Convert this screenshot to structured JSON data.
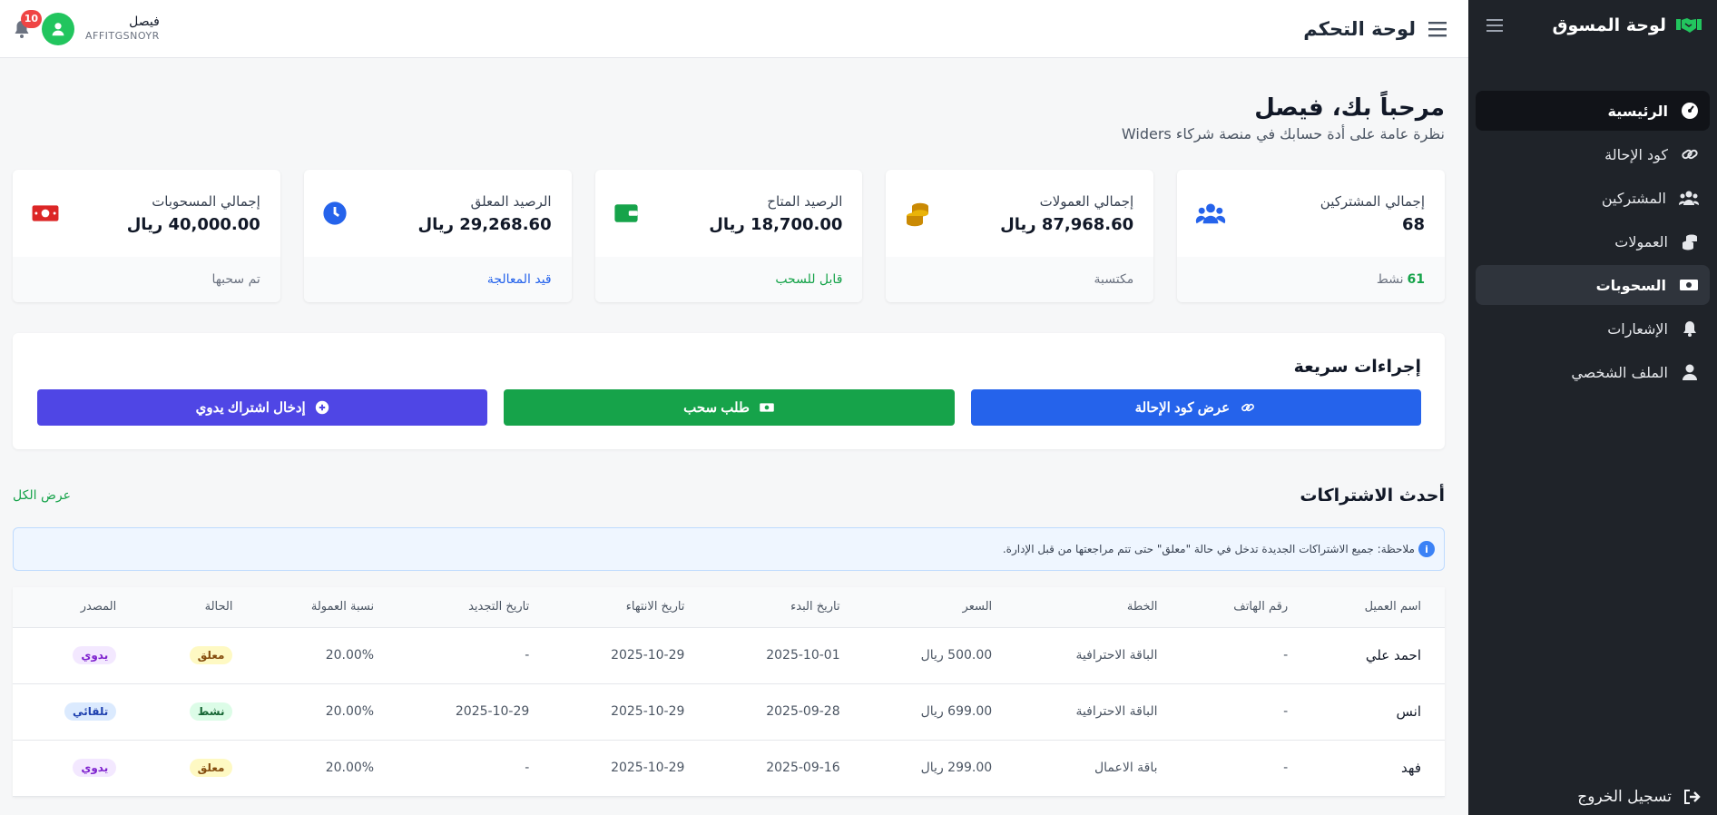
{
  "sidebar": {
    "brand": "لوحة المسوق",
    "items": [
      {
        "label": "الرئيسية",
        "icon": "gauge-icon",
        "state": "active"
      },
      {
        "label": "كود الإحالة",
        "icon": "link-icon",
        "state": ""
      },
      {
        "label": "المشتركين",
        "icon": "users-icon",
        "state": ""
      },
      {
        "label": "العمولات",
        "icon": "coins-icon",
        "state": ""
      },
      {
        "label": "السحوبات",
        "icon": "money-bill-icon",
        "state": "hover"
      },
      {
        "label": "الإشعارات",
        "icon": "bell-icon",
        "state": ""
      },
      {
        "label": "الملف الشخصي",
        "icon": "user-icon",
        "state": ""
      }
    ],
    "logout": "تسجيل الخروج"
  },
  "topbar": {
    "title": "لوحة التحكم",
    "user_name": "فيصل",
    "user_code": "AFFITGSNOYR",
    "notifications": "10"
  },
  "main": {
    "greeting": "مرحباً بك، فيصل",
    "subtitle": "نظرة عامة على أدة حسابك في منصة شركاء Widers"
  },
  "stats": [
    {
      "label": "إجمالي المشتركين",
      "value": "68",
      "footer_num": "61",
      "footer": "نشط",
      "icon": "users-icon",
      "color": "#2563eb"
    },
    {
      "label": "إجمالي العمولات",
      "value": "87,968.60 ريال",
      "footer": "مكتسبة",
      "icon": "coins-icon",
      "color": "#ca8a04"
    },
    {
      "label": "الرصيد المتاح",
      "value": "18,700.00 ريال",
      "footer": "قابل للسحب",
      "icon": "wallet-icon",
      "color": "#16a34a"
    },
    {
      "label": "الرصيد المعلق",
      "value": "29,268.60 ريال",
      "footer": "قيد المعالجة",
      "icon": "clock-icon",
      "color": "#2563eb"
    },
    {
      "label": "إجمالي المسحوبات",
      "value": "40,000.00 ريال",
      "footer": "تم سحبها",
      "icon": "money-bill-icon",
      "color": "#dc2626"
    }
  ],
  "quick_actions": {
    "title": "إجراءات سريعة",
    "buttons": [
      {
        "label": "عرض كود الإحالة",
        "icon": "link-icon",
        "color": "#2563eb"
      },
      {
        "label": "طلب سحب",
        "icon": "money-bill-icon",
        "color": "#16a34a"
      },
      {
        "label": "إدخال اشتراك يدوي",
        "icon": "plus-circle-icon",
        "color": "#4f46e5"
      }
    ]
  },
  "recent": {
    "title": "أحدث الاشتراكات",
    "view_all": "عرض الكل",
    "note": "ملاحظة: جميع الاشتراكات الجديدة تدخل في حالة \"معلق\" حتى تتم مراجعتها من قبل الإدارة.",
    "columns": [
      "اسم العميل",
      "رقم الهاتف",
      "الخطة",
      "السعر",
      "تاريخ البدء",
      "تاريخ الانتهاء",
      "تاريخ التجديد",
      "نسبة العمولة",
      "الحالة",
      "المصدر"
    ],
    "rows": [
      {
        "client": "احمد علي",
        "phone": "-",
        "plan": "الباقة الاحترافية",
        "price": "500.00 ريال",
        "start": "2025-10-01",
        "end": "2025-10-29",
        "renew": "-",
        "rate": "20.00%",
        "status": "معلق",
        "status_color": "yellow",
        "source": "يدوي",
        "source_color": "purple"
      },
      {
        "client": "انس",
        "phone": "-",
        "plan": "الباقة الاحترافية",
        "price": "699.00 ريال",
        "start": "2025-09-28",
        "end": "2025-10-29",
        "renew": "2025-10-29",
        "rate": "20.00%",
        "status": "نشط",
        "status_color": "green",
        "source": "تلقائي",
        "source_color": "blue"
      },
      {
        "client": "فهد",
        "phone": "-",
        "plan": "باقة الاعمال",
        "price": "299.00 ريال",
        "start": "2025-09-16",
        "end": "2025-10-29",
        "renew": "-",
        "rate": "20.00%",
        "status": "معلق",
        "status_color": "yellow",
        "source": "يدوي",
        "source_color": "purple"
      }
    ]
  }
}
